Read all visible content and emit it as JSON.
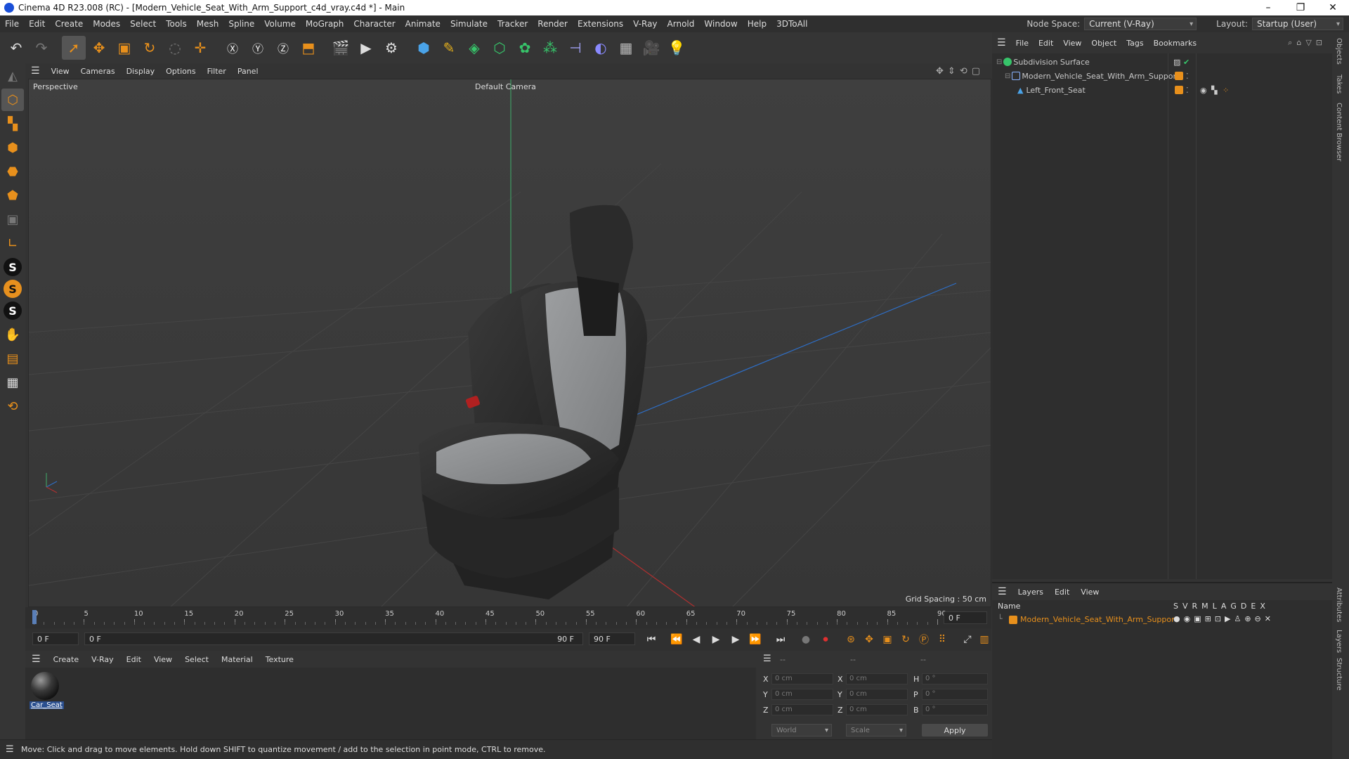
{
  "window": {
    "title": "Cinema 4D R23.008 (RC) - [Modern_Vehicle_Seat_With_Arm_Support_c4d_vray.c4d *] - Main",
    "controls": [
      "–",
      "❐",
      "✕"
    ]
  },
  "menubar": {
    "items": [
      "File",
      "Edit",
      "Create",
      "Modes",
      "Select",
      "Tools",
      "Mesh",
      "Spline",
      "Volume",
      "MoGraph",
      "Character",
      "Animate",
      "Simulate",
      "Tracker",
      "Render",
      "Extensions",
      "V-Ray",
      "Arnold",
      "Window",
      "Help",
      "3DToAll"
    ],
    "node_space_label": "Node Space:",
    "node_space_value": "Current (V-Ray)",
    "layout_label": "Layout:",
    "layout_value": "Startup (User)"
  },
  "viewport": {
    "menu": [
      "View",
      "Cameras",
      "Display",
      "Options",
      "Filter",
      "Panel"
    ],
    "label": "Perspective",
    "camera": "Default Camera",
    "grid_spacing": "Grid Spacing : 50 cm"
  },
  "timeline": {
    "ticks": [
      "0",
      "5",
      "10",
      "15",
      "20",
      "25",
      "30",
      "35",
      "40",
      "45",
      "50",
      "55",
      "60",
      "65",
      "70",
      "75",
      "80",
      "85",
      "90"
    ],
    "current_frame": "0 F",
    "start_field": "0 F",
    "range_start": "0 F",
    "range_end": "90 F",
    "end_field": "90 F"
  },
  "material_manager": {
    "menu": [
      "Create",
      "V-Ray",
      "Edit",
      "View",
      "Select",
      "Material",
      "Texture"
    ],
    "materials": [
      {
        "name": "Car_Seat"
      }
    ]
  },
  "coordinates": {
    "headers": [
      "--",
      "--",
      "--"
    ],
    "rows": [
      {
        "a": "X",
        "av": "0 cm",
        "b": "X",
        "bv": "0 cm",
        "c": "H",
        "cv": "0 °"
      },
      {
        "a": "Y",
        "av": "0 cm",
        "b": "Y",
        "bv": "0 cm",
        "c": "P",
        "cv": "0 °"
      },
      {
        "a": "Z",
        "av": "0 cm",
        "b": "Z",
        "bv": "0 cm",
        "c": "B",
        "cv": "0 °"
      }
    ],
    "space": "World",
    "mode": "Scale",
    "apply": "Apply"
  },
  "status": "Move: Click and drag to move elements. Hold down SHIFT to quantize movement / add to the selection in point mode, CTRL to remove.",
  "object_manager": {
    "menu": [
      "File",
      "Edit",
      "View",
      "Object",
      "Tags",
      "Bookmarks"
    ],
    "objects": [
      {
        "name": "Subdivision Surface"
      },
      {
        "name": "Modern_Vehicle_Seat_With_Arm_Support"
      },
      {
        "name": "Left_Front_Seat"
      }
    ]
  },
  "layer_manager": {
    "menu": [
      "Layers",
      "Edit",
      "View"
    ],
    "name_header": "Name",
    "flags": [
      "S",
      "V",
      "R",
      "M",
      "L",
      "A",
      "G",
      "D",
      "E",
      "X"
    ],
    "layers": [
      {
        "name": "Modern_Vehicle_Seat_With_Arm_Support",
        "color": "#e8901c"
      }
    ]
  },
  "side_tabs": [
    "Objects",
    "Takes",
    "Content Browser",
    "Attributes",
    "Layers",
    "Structure"
  ],
  "colors": {
    "accent": "#e8901c",
    "selection": "#2a4f8f"
  }
}
